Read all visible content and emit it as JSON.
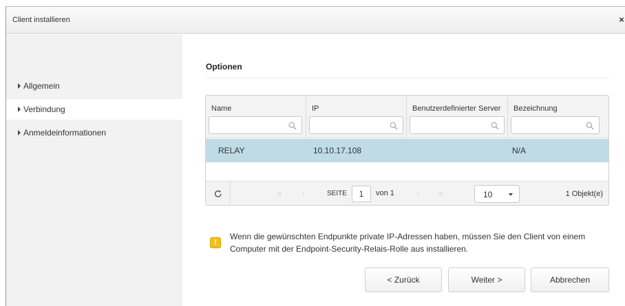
{
  "dialog": {
    "title": "Client installieren",
    "close_label": "×"
  },
  "sidebar": {
    "items": [
      {
        "label": "Allgemein"
      },
      {
        "label": "Verbindung"
      },
      {
        "label": "Anmeldeinformationen"
      }
    ]
  },
  "options": {
    "title": "Optionen",
    "columns": [
      "Name",
      "IP",
      "Benutzerdefinierter Server",
      "Bezeichnung"
    ],
    "rows": [
      {
        "name": "RELAY",
        "ip": "10.10.17.108",
        "custom_server": "",
        "label": "N/A"
      }
    ],
    "pager": {
      "first": "«",
      "prev": "‹",
      "next": "›",
      "last": "»",
      "page_label": "SEITE",
      "page_value": "1",
      "of_label": "von 1",
      "page_size": "10",
      "count_label": "1 Objekt(e)"
    }
  },
  "notice": {
    "icon": "warning-icon",
    "text": "Wenn die gewünschten Endpunkte private IP-Adressen haben, müssen Sie den Client von einem Computer mit der Endpoint-Security-Relais-Rolle aus installieren."
  },
  "buttons": {
    "back": "< Zurück",
    "next": "Weiter >",
    "cancel": "Abbrechen"
  },
  "colors": {
    "selected_row": "#bfdce6",
    "warning": "#f4c020",
    "sidebar_bg": "#f2f2f2"
  }
}
